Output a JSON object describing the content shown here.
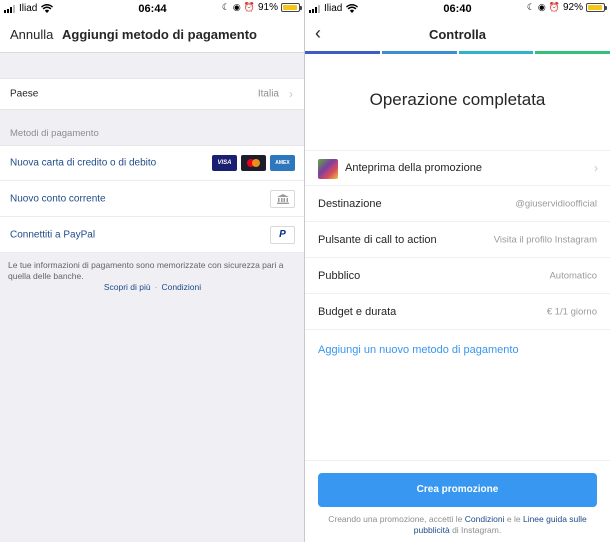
{
  "left": {
    "status": {
      "carrier": "Iliad",
      "time": "06:44",
      "battery": "91%",
      "battery_level": 0.91
    },
    "nav": {
      "cancel": "Annulla",
      "title": "Aggiungi metodo di pagamento"
    },
    "country": {
      "label": "Paese",
      "value": "Italia"
    },
    "payment_section": "Metodi di pagamento",
    "methods": [
      {
        "label": "Nuova carta di credito o di debito",
        "icons": [
          "visa-icon",
          "mastercard-icon",
          "amex-icon"
        ]
      },
      {
        "label": "Nuovo conto corrente",
        "icon": "bank-icon"
      },
      {
        "label": "Connettiti a PayPal",
        "icon": "paypal-icon"
      }
    ],
    "card_labels": {
      "visa": "VISA",
      "amex": "AMEX"
    },
    "paypal_mark": "P",
    "note": "Le tue informazioni di pagamento sono memorizzate con sicurezza pari a quella delle banche.",
    "links": {
      "learn_more": "Scopri di più",
      "separator": "·",
      "conditions": "Condizioni"
    }
  },
  "right": {
    "status": {
      "carrier": "Iliad",
      "time": "06:40",
      "battery": "92%",
      "battery_level": 0.92
    },
    "nav": {
      "title": "Controlla"
    },
    "progress_colors": [
      "#3f5bc4",
      "#3a8fd0",
      "#2fb3c9",
      "#34c07a"
    ],
    "headline": "Operazione completata",
    "rows": {
      "preview": {
        "label": "Anteprima della promozione"
      },
      "destination": {
        "label": "Destinazione",
        "value": "@giuservidioofficial"
      },
      "cta": {
        "label": "Pulsante di call to action",
        "value": "Visita il profilo Instagram"
      },
      "audience": {
        "label": "Pubblico",
        "value": "Automatico"
      },
      "budget": {
        "label": "Budget e durata",
        "value": "€ 1/1 giorno"
      }
    },
    "add_payment": "Aggiungi un nuovo metodo di pagamento",
    "create_button": "Crea promozione",
    "terms": {
      "prefix": "Creando una promozione, accetti le",
      "conditions": "Condizioni",
      "and": "e le",
      "guidelines": "Linee guida sulle pubblicità",
      "suffix": "di Instagram."
    }
  },
  "colors": {
    "link": "#1f4a8a",
    "accent": "#3897f0"
  }
}
